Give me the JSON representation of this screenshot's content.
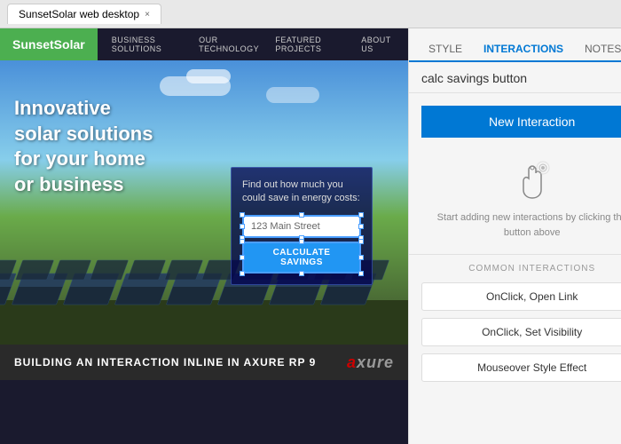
{
  "browser": {
    "tab_label": "SunsetSolar web desktop",
    "tab_close": "×"
  },
  "website": {
    "logo": "SunsetSolar",
    "nav": {
      "links": [
        "BUSINESS SOLUTIONS",
        "OUR TECHNOLOGY",
        "FEATURED PROJECTS",
        "ABOUT US"
      ]
    },
    "hero_text": "Innovative\nsolar solutions\nfor your home\nor business",
    "calc": {
      "title": "Find out how much you could save in energy costs:",
      "input_placeholder": "123 Main Street",
      "button_label": "CALCULATE SAVINGS"
    }
  },
  "bottom_bar": {
    "text": "BUILDING AN INTERACTION INLINE IN AXURE RP 9",
    "logo": "axure"
  },
  "right_panel": {
    "tabs": [
      "STYLE",
      "INTERACTIONS",
      "NOTES"
    ],
    "active_tab": "INTERACTIONS",
    "component_title": "calc savings button",
    "new_interaction_btn": "New Interaction",
    "helper_text": "Start adding new interactions\nby clicking the button above",
    "section_label": "COMMON INTERACTIONS",
    "common_interactions": [
      "OnClick, Open Link",
      "OnClick, Set Visibility",
      "Mouseover Style Effect"
    ]
  }
}
